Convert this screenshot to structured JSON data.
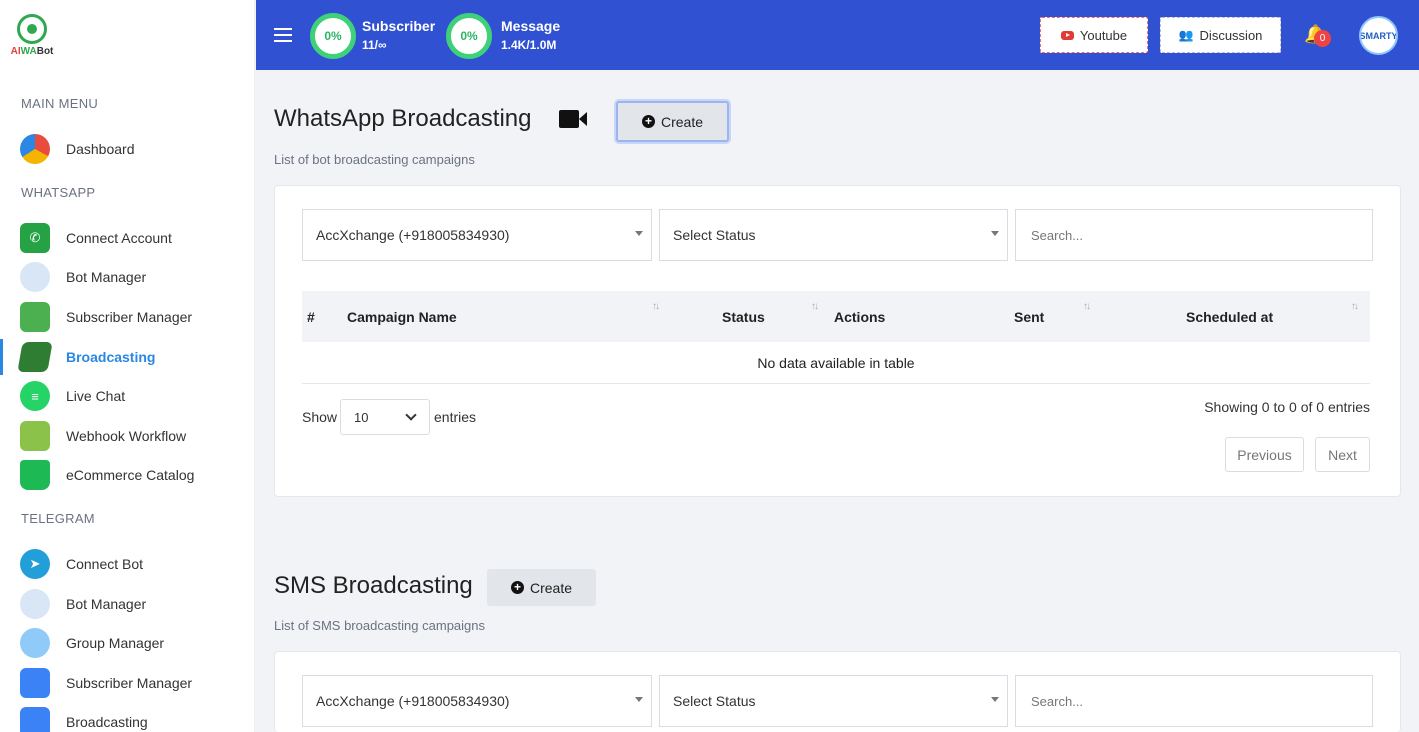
{
  "logo": {
    "ai": "AI",
    "wa": "WA",
    "bot": "Bot"
  },
  "sidebar": {
    "sections": [
      "MAIN MENU",
      "WHATSAPP",
      "TELEGRAM"
    ],
    "items": [
      {
        "label": "Dashboard",
        "icon": "speedometer-icon"
      },
      {
        "label": "Connect Account",
        "icon": "whatsapp-icon"
      },
      {
        "label": "Bot Manager",
        "icon": "robot-icon"
      },
      {
        "label": "Subscriber Manager",
        "icon": "phone-book-icon"
      },
      {
        "label": "Broadcasting",
        "icon": "megaphone-icon"
      },
      {
        "label": "Live Chat",
        "icon": "chat-icon"
      },
      {
        "label": "Webhook Workflow",
        "icon": "webhook-icon"
      },
      {
        "label": "eCommerce Catalog",
        "icon": "shopping-bag-icon"
      },
      {
        "label": "Connect Bot",
        "icon": "telegram-icon"
      },
      {
        "label": "Bot Manager",
        "icon": "robot-icon"
      },
      {
        "label": "Group Manager",
        "icon": "group-icon"
      },
      {
        "label": "Subscriber Manager",
        "icon": "phone-book-icon"
      },
      {
        "label": "Broadcasting",
        "icon": "megaphone-icon"
      }
    ]
  },
  "header": {
    "subscriber": {
      "percent": "0%",
      "label": "Subscriber",
      "value": "11/∞"
    },
    "message": {
      "percent": "0%",
      "label": "Message",
      "value": "1.4K/1.0M"
    },
    "youtube_label": "Youtube",
    "discussion_label": "Discussion",
    "notification_count": "0",
    "avatar_text": "SMARTY"
  },
  "whatsapp": {
    "title": "WhatsApp Broadcasting",
    "create_label": "Create",
    "subtitle": "List of bot broadcasting campaigns",
    "account_value": "AccXchange (+918005834930)",
    "status_value": "Select Status",
    "search_placeholder": "Search...",
    "columns": [
      "#",
      "Campaign Name",
      "Status",
      "Actions",
      "Sent",
      "Scheduled at"
    ],
    "empty_text": "No data available in table",
    "show_label": "Show",
    "entries_value": "10",
    "entries_label": "entries",
    "info_text": "Showing 0 to 0 of 0 entries",
    "previous_label": "Previous",
    "next_label": "Next"
  },
  "sms": {
    "title": "SMS Broadcasting",
    "create_label": "Create",
    "subtitle": "List of SMS broadcasting campaigns",
    "account_value": "AccXchange (+918005834930)",
    "status_value": "Select Status",
    "search_placeholder": "Search..."
  },
  "colors": {
    "header_bg": "#3151d3",
    "active": "#2a87e4",
    "gauge": "#3ed17a"
  }
}
